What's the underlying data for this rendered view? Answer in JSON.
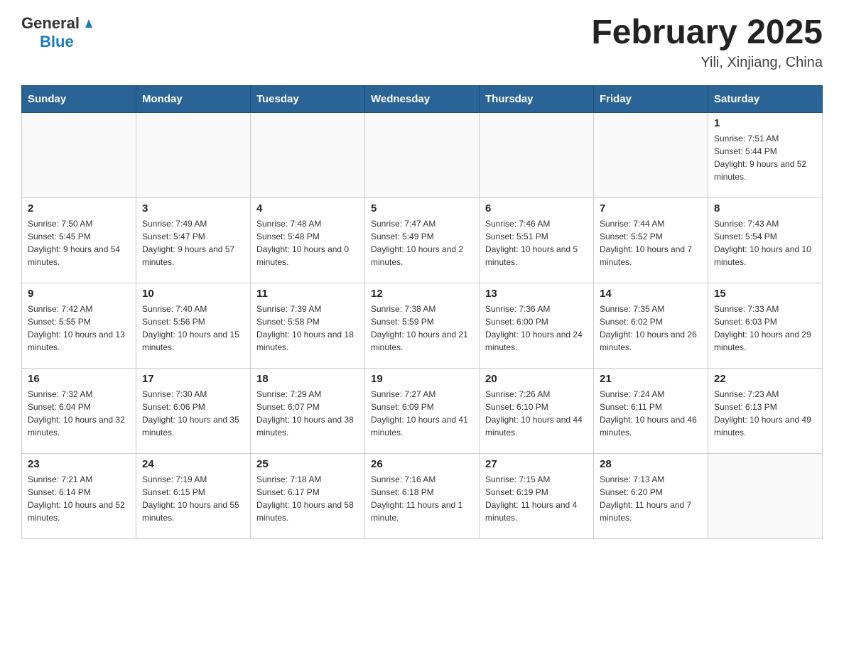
{
  "header": {
    "logo_general": "General",
    "logo_blue": "Blue",
    "title": "February 2025",
    "location": "Yili, Xinjiang, China"
  },
  "days_of_week": [
    "Sunday",
    "Monday",
    "Tuesday",
    "Wednesday",
    "Thursday",
    "Friday",
    "Saturday"
  ],
  "weeks": [
    [
      {
        "day": "",
        "info": ""
      },
      {
        "day": "",
        "info": ""
      },
      {
        "day": "",
        "info": ""
      },
      {
        "day": "",
        "info": ""
      },
      {
        "day": "",
        "info": ""
      },
      {
        "day": "",
        "info": ""
      },
      {
        "day": "1",
        "info": "Sunrise: 7:51 AM\nSunset: 5:44 PM\nDaylight: 9 hours and 52 minutes."
      }
    ],
    [
      {
        "day": "2",
        "info": "Sunrise: 7:50 AM\nSunset: 5:45 PM\nDaylight: 9 hours and 54 minutes."
      },
      {
        "day": "3",
        "info": "Sunrise: 7:49 AM\nSunset: 5:47 PM\nDaylight: 9 hours and 57 minutes."
      },
      {
        "day": "4",
        "info": "Sunrise: 7:48 AM\nSunset: 5:48 PM\nDaylight: 10 hours and 0 minutes."
      },
      {
        "day": "5",
        "info": "Sunrise: 7:47 AM\nSunset: 5:49 PM\nDaylight: 10 hours and 2 minutes."
      },
      {
        "day": "6",
        "info": "Sunrise: 7:46 AM\nSunset: 5:51 PM\nDaylight: 10 hours and 5 minutes."
      },
      {
        "day": "7",
        "info": "Sunrise: 7:44 AM\nSunset: 5:52 PM\nDaylight: 10 hours and 7 minutes."
      },
      {
        "day": "8",
        "info": "Sunrise: 7:43 AM\nSunset: 5:54 PM\nDaylight: 10 hours and 10 minutes."
      }
    ],
    [
      {
        "day": "9",
        "info": "Sunrise: 7:42 AM\nSunset: 5:55 PM\nDaylight: 10 hours and 13 minutes."
      },
      {
        "day": "10",
        "info": "Sunrise: 7:40 AM\nSunset: 5:56 PM\nDaylight: 10 hours and 15 minutes."
      },
      {
        "day": "11",
        "info": "Sunrise: 7:39 AM\nSunset: 5:58 PM\nDaylight: 10 hours and 18 minutes."
      },
      {
        "day": "12",
        "info": "Sunrise: 7:38 AM\nSunset: 5:59 PM\nDaylight: 10 hours and 21 minutes."
      },
      {
        "day": "13",
        "info": "Sunrise: 7:36 AM\nSunset: 6:00 PM\nDaylight: 10 hours and 24 minutes."
      },
      {
        "day": "14",
        "info": "Sunrise: 7:35 AM\nSunset: 6:02 PM\nDaylight: 10 hours and 26 minutes."
      },
      {
        "day": "15",
        "info": "Sunrise: 7:33 AM\nSunset: 6:03 PM\nDaylight: 10 hours and 29 minutes."
      }
    ],
    [
      {
        "day": "16",
        "info": "Sunrise: 7:32 AM\nSunset: 6:04 PM\nDaylight: 10 hours and 32 minutes."
      },
      {
        "day": "17",
        "info": "Sunrise: 7:30 AM\nSunset: 6:06 PM\nDaylight: 10 hours and 35 minutes."
      },
      {
        "day": "18",
        "info": "Sunrise: 7:29 AM\nSunset: 6:07 PM\nDaylight: 10 hours and 38 minutes."
      },
      {
        "day": "19",
        "info": "Sunrise: 7:27 AM\nSunset: 6:09 PM\nDaylight: 10 hours and 41 minutes."
      },
      {
        "day": "20",
        "info": "Sunrise: 7:26 AM\nSunset: 6:10 PM\nDaylight: 10 hours and 44 minutes."
      },
      {
        "day": "21",
        "info": "Sunrise: 7:24 AM\nSunset: 6:11 PM\nDaylight: 10 hours and 46 minutes."
      },
      {
        "day": "22",
        "info": "Sunrise: 7:23 AM\nSunset: 6:13 PM\nDaylight: 10 hours and 49 minutes."
      }
    ],
    [
      {
        "day": "23",
        "info": "Sunrise: 7:21 AM\nSunset: 6:14 PM\nDaylight: 10 hours and 52 minutes."
      },
      {
        "day": "24",
        "info": "Sunrise: 7:19 AM\nSunset: 6:15 PM\nDaylight: 10 hours and 55 minutes."
      },
      {
        "day": "25",
        "info": "Sunrise: 7:18 AM\nSunset: 6:17 PM\nDaylight: 10 hours and 58 minutes."
      },
      {
        "day": "26",
        "info": "Sunrise: 7:16 AM\nSunset: 6:18 PM\nDaylight: 11 hours and 1 minute."
      },
      {
        "day": "27",
        "info": "Sunrise: 7:15 AM\nSunset: 6:19 PM\nDaylight: 11 hours and 4 minutes."
      },
      {
        "day": "28",
        "info": "Sunrise: 7:13 AM\nSunset: 6:20 PM\nDaylight: 11 hours and 7 minutes."
      },
      {
        "day": "",
        "info": ""
      }
    ]
  ]
}
